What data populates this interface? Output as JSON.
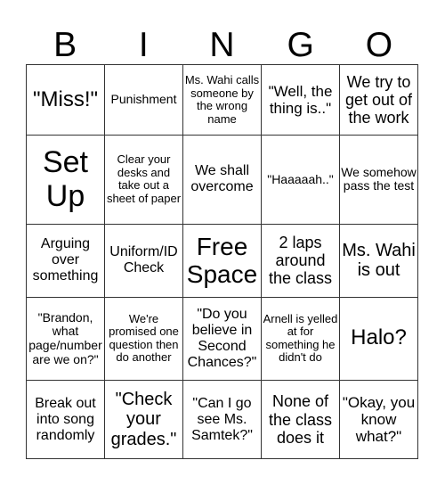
{
  "header": [
    "B",
    "I",
    "N",
    "G",
    "O"
  ],
  "rows": [
    [
      "\"Miss!\"",
      "Punishment",
      "Ms. Wahi calls someone by the wrong name",
      "\"Well, the thing is..\"",
      "We try to get out of the work"
    ],
    [
      "Set Up",
      "Clear your desks and take out a sheet of paper",
      "We shall overcome",
      "\"Haaaaah..\"",
      "We somehow pass the test"
    ],
    [
      "Arguing over something",
      "Uniform/ID Check",
      "Free Space",
      "2 laps around the class",
      "Ms. Wahi is out"
    ],
    [
      "\"Brandon, what page/number are we on?\"",
      "We're promised one question then do another",
      "\"Do you believe in Second Chances?\"",
      "Arnell is yelled at for something he didn't do",
      "Halo?"
    ],
    [
      "Break out into song randomly",
      "\"Check your grades.\"",
      "\"Can I go see Ms. Samtek?\"",
      "None of the class does it",
      "\"Okay, you know what?\""
    ]
  ]
}
